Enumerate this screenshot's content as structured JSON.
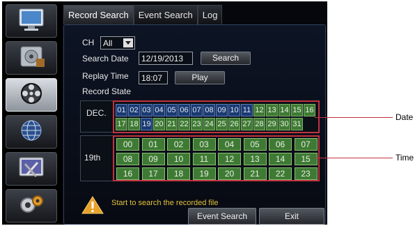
{
  "tabs": [
    {
      "label": "Record Search",
      "active": true
    },
    {
      "label": "Event Search",
      "active": false
    },
    {
      "label": "Log",
      "active": false
    }
  ],
  "sidebar": {
    "items": [
      {
        "icon": "monitor-icon",
        "active": false
      },
      {
        "icon": "disk-icon",
        "active": false
      },
      {
        "icon": "camera-reel-icon",
        "active": true
      },
      {
        "icon": "network-globe-icon",
        "active": false
      },
      {
        "icon": "system-tools-icon",
        "active": false
      },
      {
        "icon": "settings-gears-icon",
        "active": false
      }
    ]
  },
  "form": {
    "ch_label": "CH",
    "ch_value": "All",
    "search_date_label": "Search Date",
    "search_date_value": "12/19/2013",
    "search_button": "Search",
    "replay_time_label": "Replay Time",
    "replay_time_value": "18:07",
    "play_button": "Play",
    "record_state_label": "Record State"
  },
  "date_grid": {
    "month_label": "DEC.",
    "days": [
      "01",
      "02",
      "03",
      "04",
      "05",
      "06",
      "07",
      "08",
      "09",
      "10",
      "11",
      "12",
      "13",
      "14",
      "15",
      "16",
      "17",
      "18",
      "19",
      "20",
      "21",
      "22",
      "23",
      "24",
      "25",
      "26",
      "27",
      "28",
      "29",
      "30",
      "31"
    ],
    "days_with_data": [
      "12",
      "13",
      "14",
      "15",
      "16",
      "17",
      "18",
      "20",
      "21",
      "22",
      "23",
      "24",
      "25",
      "26",
      "27",
      "28",
      "29",
      "30",
      "31"
    ],
    "annotation": "Date"
  },
  "time_grid": {
    "day_label": "19th",
    "hours": [
      "00",
      "01",
      "02",
      "03",
      "04",
      "05",
      "06",
      "07",
      "08",
      "09",
      "10",
      "11",
      "12",
      "13",
      "14",
      "15",
      "16",
      "17",
      "18",
      "19",
      "20",
      "21",
      "22",
      "23"
    ],
    "annotation": "Time"
  },
  "status": {
    "message": "Start to search the recorded file",
    "event_search_button": "Event Search",
    "exit_button": "Exit"
  },
  "colors": {
    "recorded": "#3f7a34",
    "not_recorded": "#1a3a72",
    "highlight_border": "#c0333f"
  }
}
